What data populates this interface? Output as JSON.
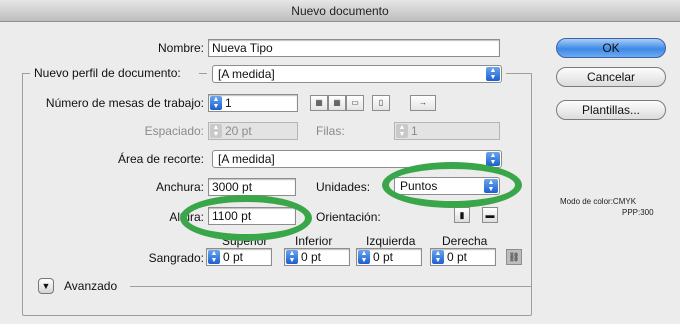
{
  "window": {
    "title": "Nuevo documento"
  },
  "form": {
    "name_label": "Nombre:",
    "name_value": "Nueva Tipo",
    "profile_label": "Nuevo perfil de documento:",
    "profile_value": "[A medida]",
    "artboards_label": "Número de mesas de trabajo:",
    "artboards_value": "1",
    "arrow_glyph": "→",
    "spacing_label": "Espaciado:",
    "spacing_value": "20 pt",
    "rows_label": "Filas:",
    "rows_value": "1",
    "bleed_area_label": "Área de recorte:",
    "bleed_area_value": "[A medida]",
    "width_label": "Anchura:",
    "width_value": "3000 pt",
    "units_label": "Unidades:",
    "units_value": "Puntos",
    "height_label": "Altura:",
    "height_value": "1100 pt",
    "orientation_label": "Orientación:",
    "bleed_label": "Sangrado:",
    "bleed_headers": [
      "Superior",
      "Inferior",
      "Izquierda",
      "Derecha"
    ],
    "bleed_values": [
      "0 pt",
      "0 pt",
      "0 pt",
      "0 pt"
    ],
    "advanced_label": "Avanzado"
  },
  "buttons": {
    "ok": "OK",
    "cancel": "Cancelar",
    "templates": "Plantillas..."
  },
  "info": {
    "color_mode": "Modo de color:CMYK",
    "ppp": "PPP:300"
  },
  "colors": {
    "highlight": "#3aa64a",
    "accent": "#2d6fd6"
  }
}
